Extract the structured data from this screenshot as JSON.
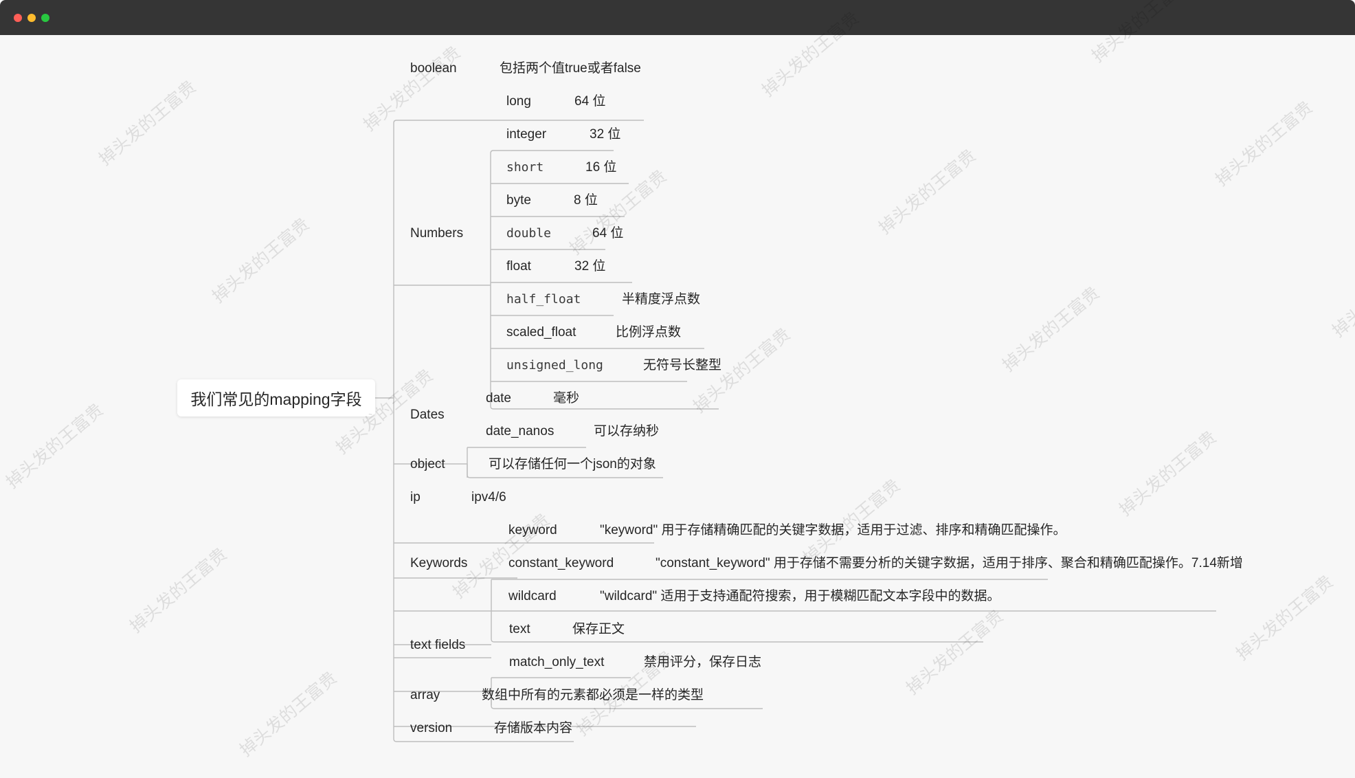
{
  "window": {
    "controls": {
      "close_color": "#ff5f57",
      "minimize_color": "#febc2e",
      "maximize_color": "#28c840"
    }
  },
  "mindmap": {
    "root": "我们常见的mapping字段",
    "line_color": "#bdbdbd",
    "boolean": {
      "label": "boolean",
      "desc": "包括两个值true或者false"
    },
    "numbers": {
      "label": "Numbers",
      "items": [
        {
          "name": "long",
          "desc": "64 位"
        },
        {
          "name": "integer",
          "desc": "32 位"
        },
        {
          "name": "short",
          "desc": "16 位"
        },
        {
          "name": "byte",
          "desc": "8 位"
        },
        {
          "name": "double",
          "desc": "64 位"
        },
        {
          "name": "float",
          "desc": "32 位"
        },
        {
          "name": "half_float",
          "desc": "半精度浮点数"
        },
        {
          "name": "scaled_float",
          "desc": "比例浮点数"
        },
        {
          "name": "unsigned_long",
          "desc": "无符号长整型"
        }
      ]
    },
    "dates": {
      "label": "Dates",
      "items": [
        {
          "name": "date",
          "desc": "毫秒"
        },
        {
          "name": "date_nanos",
          "desc": "可以存纳秒"
        }
      ]
    },
    "object": {
      "label": "object",
      "desc": "可以存储任何一个json的对象"
    },
    "ip": {
      "label": "ip",
      "desc": "ipv4/6"
    },
    "keywords": {
      "label": "Keywords",
      "items": [
        {
          "name": "keyword",
          "desc": "\"keyword\" 用于存储精确匹配的关键字数据，适用于过滤、排序和精确匹配操作。"
        },
        {
          "name": "constant_keyword",
          "desc": "\"constant_keyword\" 用于存储不需要分析的关键字数据，适用于排序、聚合和精确匹配操作。7.14新增"
        },
        {
          "name": "wildcard",
          "desc": "\"wildcard\" 适用于支持通配符搜索，用于模糊匹配文本字段中的数据。"
        }
      ]
    },
    "text_fields": {
      "label": "text fields",
      "items": [
        {
          "name": "text",
          "desc": "保存正文"
        },
        {
          "name": "match_only_text",
          "desc": "禁用评分，保存日志"
        }
      ]
    },
    "array": {
      "label": "array",
      "desc": "数组中所有的元素都必须是一样的类型"
    },
    "version": {
      "label": "version",
      "desc": "存储版本内容"
    }
  },
  "watermark": {
    "text": "掉头发的王富贵"
  }
}
